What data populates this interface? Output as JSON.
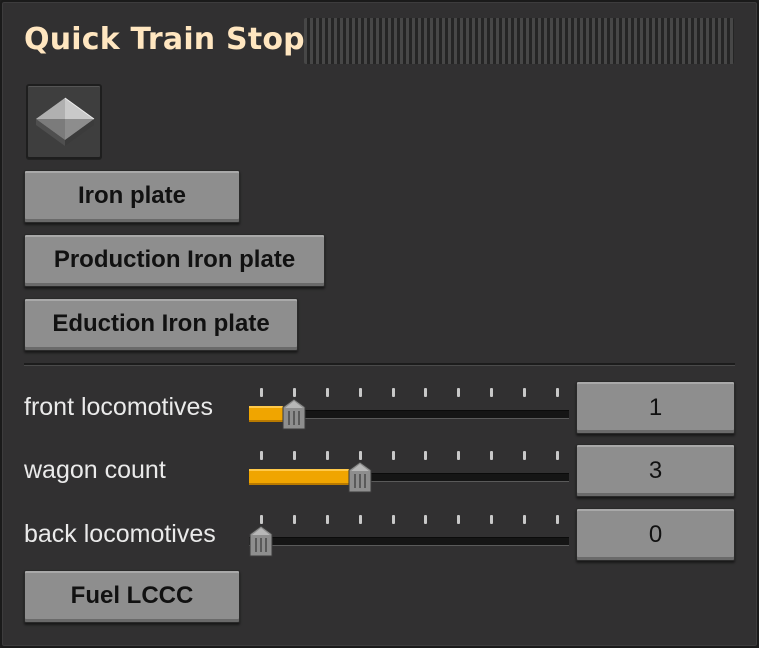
{
  "window": {
    "title": "Quick Train Stop"
  },
  "item": {
    "icon": "iron-plate-icon"
  },
  "buttons": {
    "iron_plate": "Iron plate",
    "production_iron_plate": "Production Iron plate",
    "eduction_iron_plate": "Eduction Iron plate",
    "fuel": "Fuel LCCC"
  },
  "sliders": [
    {
      "label": "front locomotives",
      "value": "1",
      "level": 1,
      "max": 9,
      "ticks": 10
    },
    {
      "label": "wagon count",
      "value": "3",
      "level": 3,
      "max": 9,
      "ticks": 10
    },
    {
      "label": "back locomotives",
      "value": "0",
      "level": 0,
      "max": 9,
      "ticks": 10
    }
  ],
  "colors": {
    "accent": "#f0a500",
    "title": "#ffe6c0",
    "panel": "#313031",
    "button": "#8e8e8e"
  }
}
